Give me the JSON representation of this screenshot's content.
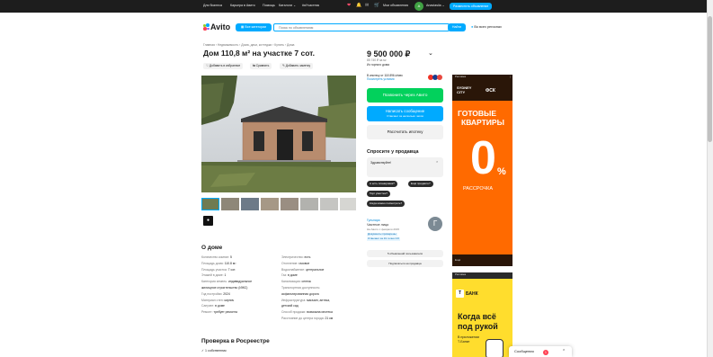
{
  "topnav": {
    "business": "Для бизнеса",
    "career": "Карьера в Авито",
    "help": "Помощь",
    "catalogs": "Каталоги ⌄",
    "fintech": "#яУчастник",
    "my_ads": "Мои объявления",
    "user": "Anastasiia ⌄",
    "post_ad": "Разместить объявление",
    "avatar_letter": "A"
  },
  "header": {
    "logo": "Avito",
    "categories_btn": "Все категории",
    "search_placeholder": "Поиск по объявлениям",
    "find_btn": "Найти",
    "region": "Во всех регионах"
  },
  "breadcrumb": "Главная › Недвижимость › Дома, дачи, коттеджи › Купить › Дома",
  "listing": {
    "title": "Дом 110,8 м² на участке 7 сот.",
    "add_fav": "Добавить в избранное",
    "compare": "Сравнить",
    "add_note": "Добавить заметку"
  },
  "price": {
    "value": "9 500 000 ₽",
    "per_m2": "85 740 ₽ за м²",
    "meet": "Из горного дома",
    "mortgage_text": "В ипотеку от 118 896 ₽/мес",
    "mortgage_link": "Посмотреть условия"
  },
  "actions": {
    "call": "Позвонить через Авито",
    "message": "Написать сообщение",
    "message_sub": "Отвечает за несколько часов",
    "calc": "Рассчитать ипотеку"
  },
  "ask": {
    "title": "Спросите у продавца",
    "greeting": "Здравствуйте!",
    "q1": "А есть планировка?",
    "q2": "Ещё продаёте?",
    "q3": "Торг уместен?",
    "q4": "Когда можно посмотреть?"
  },
  "seller": {
    "name": "Гульнара",
    "type": "Частное лицо",
    "since": "На Авито с февраля 2015",
    "docs": "Документы проверены",
    "responds": "Отвечает за 31 точно СО",
    "avatar": "Г",
    "ads_btn": "5 объявлений пользователя",
    "subscribe": "Подписаться на продавца"
  },
  "about": {
    "title": "О доме",
    "left": [
      {
        "k": "Количество комнат:",
        "v": "5"
      },
      {
        "k": "Площадь дома:",
        "v": "110.8 м²"
      },
      {
        "k": "Площадь участка:",
        "v": "7 сот."
      },
      {
        "k": "Этажей в доме:",
        "v": "1"
      },
      {
        "k": "Категория земель:",
        "v": "индивидуальное"
      },
      {
        "k": "",
        "v": "жилищное строительство (ИЖС)"
      },
      {
        "k": "Год постройки:",
        "v": "2024"
      },
      {
        "k": "Материал стен:",
        "v": "кирпич"
      },
      {
        "k": "Санузел:",
        "v": "в доме"
      },
      {
        "k": "Ремонт:",
        "v": "требует ремонта"
      }
    ],
    "right": [
      {
        "k": "Электричество:",
        "v": "есть"
      },
      {
        "k": "Отопление:",
        "v": "газовое"
      },
      {
        "k": "Водоснабжение:",
        "v": "центральное"
      },
      {
        "k": "Газ:",
        "v": "в доме"
      },
      {
        "k": "Канализация:",
        "v": "септик"
      },
      {
        "k": "Транспортная доступность:",
        "v": ""
      },
      {
        "k": "",
        "v": "асфальтированная дорога"
      },
      {
        "k": "Инфраструктура:",
        "v": "магазин, аптека,"
      },
      {
        "k": "",
        "v": "детский сад"
      },
      {
        "k": "Способ продажи:",
        "v": "возможна ипотека"
      },
      {
        "k": "Расстояние до центра города:",
        "v": "21 км"
      }
    ]
  },
  "rosreestr": {
    "title": "Проверка в Росреестре",
    "owners": "✓ 1 собственник"
  },
  "ad1": {
    "label": "Реклама",
    "brand1": "SYDNEY CITY",
    "brand2": "ФСК",
    "line1": "ГОТОВЫЕ",
    "line2": "КВАРТИРЫ",
    "zero": "0",
    "pct": "%",
    "installment": "РАССРОЧКА",
    "footer": "Ещё"
  },
  "ad2": {
    "label": "Реклама",
    "bank": "БАНК",
    "line1": "Когда всё",
    "line2": "под рукой",
    "line3": "В приложении",
    "line4": "Т-Банке"
  },
  "messages": {
    "label": "Сообщения",
    "count": "1"
  },
  "colors": {
    "dark": "#1d1d1d",
    "blue": "#00aaff",
    "green": "#02d15c",
    "avito_green": "#97cf26",
    "ad_orange": "#ff6a00",
    "ad_yellow": "#ffdd2d"
  }
}
